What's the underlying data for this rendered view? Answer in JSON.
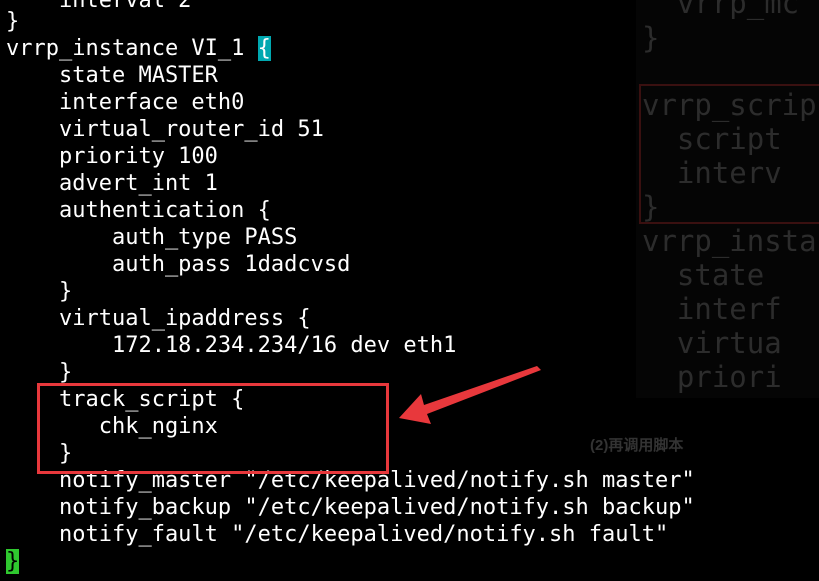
{
  "terminal": {
    "lines": [
      "    interval 2",
      "}",
      "vrrp_instance VI_1 ",
      "    state MASTER",
      "    interface eth0",
      "    virtual_router_id 51",
      "    priority 100",
      "    advert_int 1",
      "    authentication {",
      "        auth_type PASS",
      "        auth_pass 1dadcvsd",
      "    }",
      "    virtual_ipaddress {",
      "        172.18.234.234/16 dev eth1",
      "    }",
      "    track_script {",
      "       chk_nginx",
      "    }",
      "    notify_master \"/etc/keepalived/notify.sh master\"",
      "    notify_backup \"/etc/keepalived/notify.sh backup\"",
      "    notify_fault \"/etc/keepalived/notify.sh fault\"",
      ""
    ],
    "open_brace_cursor": "{",
    "final_brace_cursor": "}"
  },
  "background_panel": {
    "lines": [
      "  vrrp_mc",
      "}",
      "vrrp_scrip",
      "  script",
      "  interv",
      "}",
      "vrrp_insta",
      "  state",
      "  interf",
      "  virtua",
      "  priori"
    ]
  },
  "annotation": {
    "caption": "(2)再调用脚本",
    "highlight_color": "#e8383c"
  },
  "colors": {
    "background": "#000000",
    "text": "#ffffff",
    "cursor_teal": "#00a8b0",
    "cursor_green": "#2fc82f"
  }
}
